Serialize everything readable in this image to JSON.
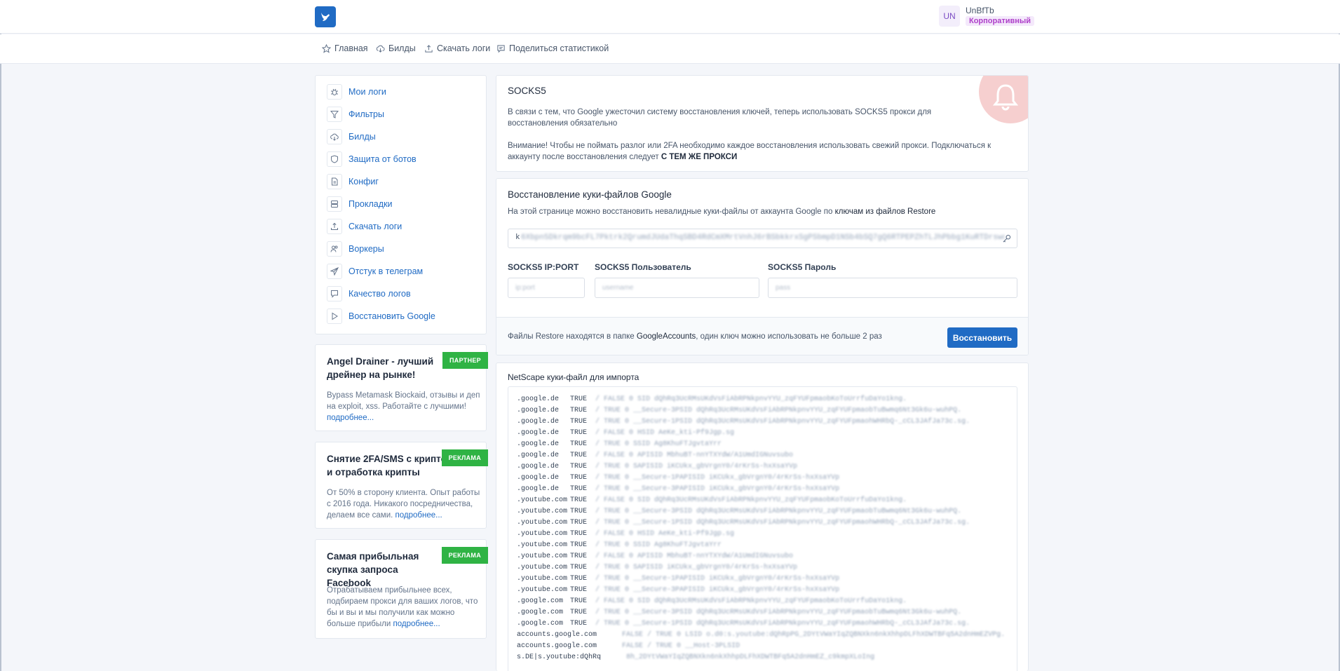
{
  "header": {
    "user_initials": "UN",
    "user_name": "UnBfTb",
    "user_plan": "Корпоративный"
  },
  "nav": [
    {
      "label": "Главная",
      "icon": "star-icon"
    },
    {
      "label": "Билды",
      "icon": "cloud-download-icon"
    },
    {
      "label": "Скачать логи",
      "icon": "upload-icon"
    },
    {
      "label": "Поделиться статистикой",
      "icon": "message-icon"
    }
  ],
  "sidebar": {
    "items": [
      {
        "label": "Мои логи",
        "icon": "bug-icon"
      },
      {
        "label": "Фильтры",
        "icon": "filter-icon"
      },
      {
        "label": "Билды",
        "icon": "cloud-download-icon"
      },
      {
        "label": "Защита от ботов",
        "icon": "shield-icon"
      },
      {
        "label": "Конфиг",
        "icon": "file-icon"
      },
      {
        "label": "Прокладки",
        "icon": "server-icon"
      },
      {
        "label": "Скачать логи",
        "icon": "upload-icon"
      },
      {
        "label": "Воркеры",
        "icon": "users-icon"
      },
      {
        "label": "Отстук в телеграм",
        "icon": "send-icon"
      },
      {
        "label": "Качество логов",
        "icon": "message-icon"
      },
      {
        "label": "Восстановить Google",
        "icon": "play-icon"
      }
    ]
  },
  "ads": [
    {
      "title": "Angel Drainer - лучший дрейнер на рынке!",
      "text": "Bypass Metamask Biockaid, отзывы и деп на exploit, xss. Работайте с лучшими!",
      "more": "подробнее...",
      "badge": "ПАРТНЕР"
    },
    {
      "title": "Снятие 2FA/SMS с крипто-бирж и отработка крипты",
      "text": "От 50% в сторону клиента. Опыт работы с 2016 года. Никакого посредничества, делаем все сами.",
      "more": "подробнее...",
      "badge": "РЕКЛАМА"
    },
    {
      "title": "Самая прибыльная скупка запроса Facebook",
      "text": "Отрабатываем прибыльнее всех, подбираем прокси для ваших логов, что бы и вы и мы получили как можно больше прибыли",
      "more": "подробнее...",
      "badge": "РЕКЛАМА"
    }
  ],
  "socks_notice": {
    "title": "SOCKS5",
    "p1": "В связи с тем, что Google ужесточил систему восстановления ключей, теперь использовать SOCKS5 прокси для восстановления обязательно",
    "p2": "Внимание! Чтобы не поймать разлог или 2FA необходимо каждое восстановления использовать свежий прокси. Подключаться к аккаунту после восстановления следует",
    "p2_strong": "С ТЕМ ЖЕ ПРОКСИ"
  },
  "restore": {
    "title": "Восстановление куки-файлов Google",
    "desc": "На этой странице можно восстановить невалидные куки-файлы от аккаунта Google по",
    "desc_strong": "ключам из файлов Restore",
    "key_lead": "k",
    "key_value": "6Xbpn5Dkrqm9bcFL7Pktrk2QrumdJUdaThqSBD4RdCmXMrtVnhJ6rBSbkkrxSgPSbmpD1NSb4bSQ7gQ6RTPEPZhTLJhPbbg1KuRTDrswdZ",
    "fields": [
      {
        "label": "SOCKS5 IP:PORT",
        "placeholder": "ip:port"
      },
      {
        "label": "SOCKS5 Пользователь",
        "placeholder": "username"
      },
      {
        "label": "SOCKS5 Пароль",
        "placeholder": "pass"
      }
    ],
    "footer_text": "Файлы Restore находятся в папке",
    "footer_strong": "GoogleAccounts",
    "footer_tail": ", один ключ можно использовать не больше 2 раз",
    "button": "Восстановить"
  },
  "netscape": {
    "title": "NetScape куки-файл для импорта",
    "lines": [
      {
        "domain": ".google.de",
        "flag": "TRUE",
        "rest": "/  FALSE 0  SID  dQhRq3UcRMsUKdVsFiAbRPNkpnvYYU_zqFYUFpmaobKoToUrrfuDaYo1kng."
      },
      {
        "domain": ".google.de",
        "flag": "TRUE",
        "rest": "/  TRUE 0  __Secure-3PSID  dQhRq3UcRMsUKdVsFiAbRPNkpnvYYU_zqFYUFpmaobTuBwmq6Nt3Gk6u-wuhPQ."
      },
      {
        "domain": ".google.de",
        "flag": "TRUE",
        "rest": "/  TRUE 0  __Secure-1PSID  dQhRq3UcRMsUKdVsFiAbRPNkpnvYYU_zqFYUFpmaohWHRbQ-_cCL3JAfJa73c.sg."
      },
      {
        "domain": ".google.de",
        "flag": "TRUE",
        "rest": "/  FALSE 0  HSID  AeKe_kti-Pf9Jgp.sg"
      },
      {
        "domain": ".google.de",
        "flag": "TRUE",
        "rest": "/  TRUE 0  SSID  Ag8KhuFTJgvtaYrr"
      },
      {
        "domain": ".google.de",
        "flag": "TRUE",
        "rest": "/  FALSE 0  APISID  MbhuBT-nnYTXYdW/A1UmdIGNuvsubo"
      },
      {
        "domain": ".google.de",
        "flag": "TRUE",
        "rest": "/  TRUE 0  SAPISID  iKCUkx_gbVrgnY0/4rKrSs-hxXsaYVp"
      },
      {
        "domain": ".google.de",
        "flag": "TRUE",
        "rest": "/  TRUE 0  __Secure-1PAPISID  iKCUkx_gbVrgnY0/4rKrSs-hxXsaYVp"
      },
      {
        "domain": ".google.de",
        "flag": "TRUE",
        "rest": "/  TRUE 0  __Secure-3PAPISID  iKCUkx_gbVrgnY0/4rKrSs-hxXsaYVp"
      },
      {
        "domain": ".youtube.com",
        "flag": "TRUE",
        "rest": "/  FALSE 0  SID  dQhRq3UcRMsUKdVsFiAbRPNkpnvYYU_zqFYUFpmaobKoToUrrfuDaYo1kng."
      },
      {
        "domain": ".youtube.com",
        "flag": "TRUE",
        "rest": "/  TRUE 0  __Secure-3PSID  dQhRq3UcRMsUKdVsFiAbRPNkpnvYYU_zqFYUFpmaobTuBwmq6Nt3Gk6u-wuhPQ."
      },
      {
        "domain": ".youtube.com",
        "flag": "TRUE",
        "rest": "/  TRUE 0  __Secure-1PSID  dQhRq3UcRMsUKdVsFiAbRPNkpnvYYU_zqFYUFpmaohWHRbQ-_cCL3JAfJa73c.sg."
      },
      {
        "domain": ".youtube.com",
        "flag": "TRUE",
        "rest": "/  FALSE 0  HSID  AeKe_kti-Pf9Jgp.sg"
      },
      {
        "domain": ".youtube.com",
        "flag": "TRUE",
        "rest": "/  TRUE 0  SSID  Ag8KhuFTJgvtaYrr"
      },
      {
        "domain": ".youtube.com",
        "flag": "TRUE",
        "rest": "/  FALSE 0  APISID  MbhuBT-nnYTXYdW/A1UmdIGNuvsubo"
      },
      {
        "domain": ".youtube.com",
        "flag": "TRUE",
        "rest": "/  TRUE 0  SAPISID  iKCUkx_gbVrgnY0/4rKrSs-hxXsaYVp"
      },
      {
        "domain": ".youtube.com",
        "flag": "TRUE",
        "rest": "/  TRUE 0  __Secure-1PAPISID  iKCUkx_gbVrgnY0/4rKrSs-hxXsaYVp"
      },
      {
        "domain": ".youtube.com",
        "flag": "TRUE",
        "rest": "/  TRUE 0  __Secure-3PAPISID  iKCUkx_gbVrgnY0/4rKrSs-hxXsaYVp"
      },
      {
        "domain": ".google.com",
        "flag": "TRUE",
        "rest": "/  FALSE 0  SID  dQhRq3UcRMsUKdVsFiAbRPNkpnvYYU_zqFYUFpmaobKoToUrrfuDaYo1kng."
      },
      {
        "domain": ".google.com",
        "flag": "TRUE",
        "rest": "/  TRUE 0  __Secure-3PSID  dQhRq3UcRMsUKdVsFiAbRPNkpnvYYU_zqFYUFpmaobTuBwmq6Nt3Gk6u-wuhPQ."
      },
      {
        "domain": ".google.com",
        "flag": "TRUE",
        "rest": "/  TRUE 0  __Secure-1PSID  dQhRq3UcRMsUKdVsFiAbRPNkpnvYYU_zqFYUFpmaohWHRbQ-_cCL3JAfJa73c.sg."
      },
      {
        "domain": "accounts.google.com",
        "flag": "",
        "rest": "FALSE /  TRUE 0  LSID  o.d0:s.youtube:dQhRpPG_2DYtVWaYIqZQBNXkn6nkXhhpDLFhXDWTBFq5A2dnHmEZVPg."
      },
      {
        "domain": "accounts.google.com",
        "flag": "",
        "rest": "FALSE /  TRUE 0  __Host-3PLSID  "
      },
      {
        "domain": "s.DE|s.youtube:dQhRq",
        "flag": "",
        "rest": "8h_2DYtVWaYIqZQBNXkn6nkXhhpDLFhXDWTBFq5A2dnHmEZ_c9kmpXLoIng"
      }
    ]
  }
}
